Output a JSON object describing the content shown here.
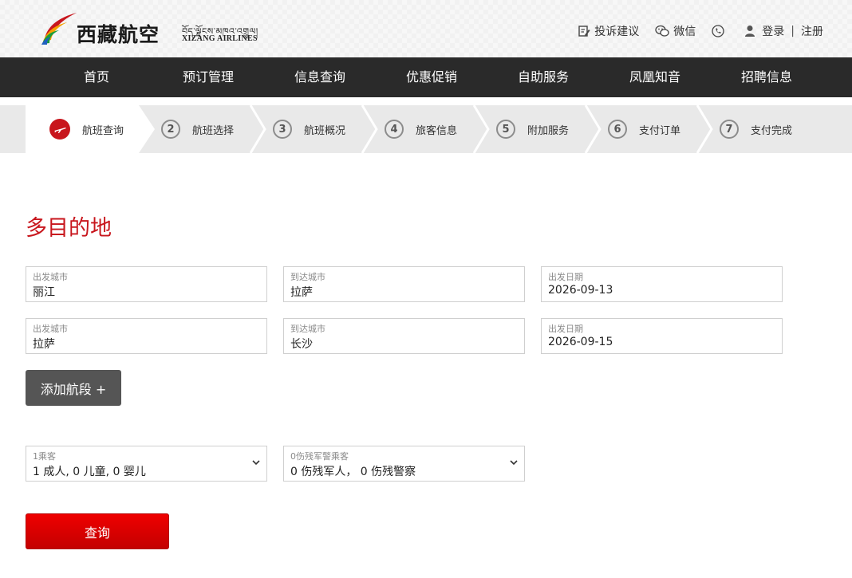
{
  "brand": {
    "name_cn": "西藏航空",
    "name_tibetan": "བོད་ལྗོངས་མཁའ་འགྲུལ།",
    "name_en": "XIZANG AIRLINES"
  },
  "toplinks": {
    "complaint": "投诉建议",
    "wechat": "微信",
    "login": "登录",
    "separator": "|",
    "register": "注册"
  },
  "nav": [
    {
      "label": "首页"
    },
    {
      "label": "预订管理"
    },
    {
      "label": "信息查询"
    },
    {
      "label": "优惠促销"
    },
    {
      "label": "自助服务"
    },
    {
      "label": "凤凰知音"
    },
    {
      "label": "招聘信息"
    }
  ],
  "steps": [
    {
      "num": "",
      "label": "航班查询",
      "active": true
    },
    {
      "num": "2",
      "label": "航班选择"
    },
    {
      "num": "3",
      "label": "航班概况"
    },
    {
      "num": "4",
      "label": "旅客信息"
    },
    {
      "num": "5",
      "label": "附加服务"
    },
    {
      "num": "6",
      "label": "支付订单"
    },
    {
      "num": "7",
      "label": "支付完成"
    }
  ],
  "main": {
    "title": "多目的地",
    "segments": [
      {
        "from": {
          "label": "出发城市",
          "value": "丽江"
        },
        "to": {
          "label": "到达城市",
          "value": "拉萨"
        },
        "date": {
          "label": "出发日期",
          "value": "2026-09-13"
        }
      },
      {
        "from": {
          "label": "出发城市",
          "value": "拉萨"
        },
        "to": {
          "label": "到达城市",
          "value": "长沙"
        },
        "date": {
          "label": "出发日期",
          "value": "2026-09-15"
        }
      }
    ],
    "add_segment_label": "添加航段 +",
    "passengers": {
      "label": "1乘客",
      "value": "1 成人, 0 儿童, 0 婴儿"
    },
    "special_passengers": {
      "label": "0伤残军警乘客",
      "value": "0 伤残军人，  0 伤残警察"
    },
    "search_label": "查询"
  },
  "colors": {
    "brand_red": "#c8161d",
    "nav_bg": "#2a2a2a",
    "steps_bg": "#e9e9e9",
    "button_gray": "#555555",
    "search_red": "#e60000"
  }
}
